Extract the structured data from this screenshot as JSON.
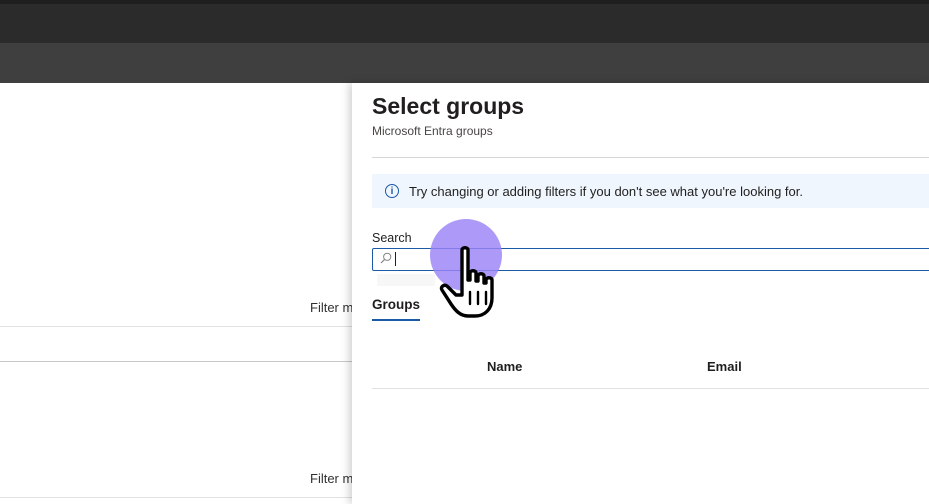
{
  "background": {
    "filter_label_1": "Filter m",
    "filter_label_2": "Filter m"
  },
  "panel": {
    "title": "Select groups",
    "subtitle": "Microsoft Entra groups",
    "info_text": "Try changing or adding filters if you don't see what you're looking for.",
    "info_icon_glyph": "i",
    "search": {
      "label": "Search",
      "value": ""
    },
    "tabs": [
      {
        "label": "Groups",
        "selected": true
      }
    ],
    "table": {
      "columns": [
        "Name",
        "Email"
      ]
    }
  },
  "icons": {
    "info": "info-icon",
    "search": "search-icon",
    "cursor": "hand-pointer-cursor"
  },
  "colors": {
    "accent": "#1a5aa6",
    "info_bg": "#f0f6fd",
    "cursor_highlight": "#9b82f5"
  }
}
